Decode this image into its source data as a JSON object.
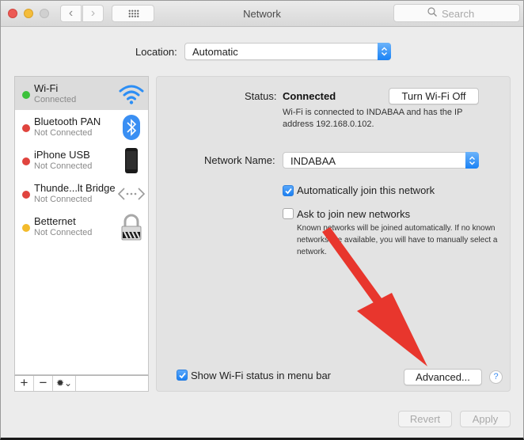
{
  "window": {
    "title": "Network",
    "search_placeholder": "Search",
    "back_glyph": "‹",
    "forward_glyph": "›"
  },
  "location": {
    "label": "Location:",
    "value": "Automatic"
  },
  "sidebar": {
    "items": [
      {
        "name": "Wi-Fi",
        "status": "Connected",
        "status_color": "#3cc13b",
        "icon": "wifi-icon",
        "selected": true
      },
      {
        "name": "Bluetooth PAN",
        "status": "Not Connected",
        "status_color": "#e0443e",
        "icon": "bluetooth-icon",
        "selected": false
      },
      {
        "name": "iPhone USB",
        "status": "Not Connected",
        "status_color": "#e0443e",
        "icon": "iphone-icon",
        "selected": false
      },
      {
        "name": "Thunde...lt Bridge",
        "status": "Not Connected",
        "status_color": "#e0443e",
        "icon": "bridge-icon",
        "selected": false
      },
      {
        "name": "Betternet",
        "status": "Not Connected",
        "status_color": "#f3bb2c",
        "icon": "lock-icon",
        "selected": false
      }
    ],
    "footer": {
      "add_label": "+",
      "remove_label": "−",
      "gear_label": "✹⌄"
    }
  },
  "detail": {
    "status_label": "Status:",
    "status_value": "Connected",
    "turn_off_label": "Turn Wi-Fi Off",
    "status_description": "Wi-Fi is connected to INDABAA and has the IP address 192.168.0.102.",
    "network_name_label": "Network Name:",
    "network_name_value": "INDABAA",
    "auto_join_label": "Automatically join this network",
    "auto_join_checked": true,
    "ask_join_label": "Ask to join new networks",
    "ask_join_checked": false,
    "ask_join_note": "Known networks will be joined automatically. If no known networks are available, you will have to manually select a network.",
    "show_status_label": "Show Wi-Fi status in menu bar",
    "show_status_checked": true,
    "advanced_label": "Advanced...",
    "help_label": "?"
  },
  "footer": {
    "revert_label": "Revert",
    "apply_label": "Apply"
  },
  "annotation": {
    "arrow_color": "#e8362d",
    "points_to": "Advanced..."
  }
}
